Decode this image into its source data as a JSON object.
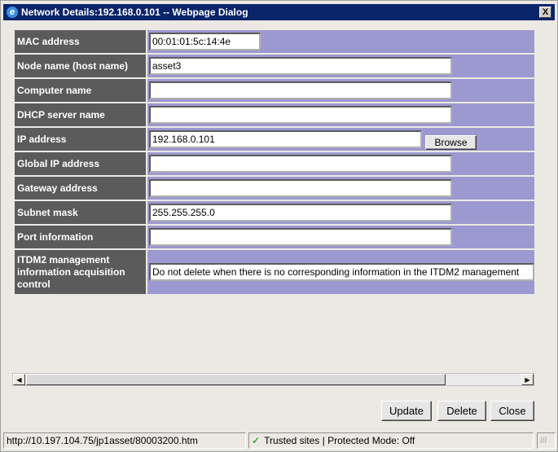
{
  "window": {
    "title": "Network Details:192.168.0.101 -- Webpage Dialog",
    "close_label": "X"
  },
  "fields": [
    {
      "label": "MAC address",
      "value": "00:01:01:5c:14:4e"
    },
    {
      "label": "Node name (host name)",
      "value": "asset3"
    },
    {
      "label": "Computer name",
      "value": ""
    },
    {
      "label": "DHCP server name",
      "value": ""
    },
    {
      "label": "IP address",
      "value": "192.168.0.101",
      "button": "Browse"
    },
    {
      "label": "Global IP address",
      "value": ""
    },
    {
      "label": "Gateway address",
      "value": ""
    },
    {
      "label": "Subnet mask",
      "value": "255.255.255.0"
    },
    {
      "label": "Port information",
      "value": ""
    },
    {
      "label": "ITDM2 management information acquisition control",
      "value": "Do not delete when there is no corresponding information in the ITDM2 management"
    }
  ],
  "buttons": {
    "update": "Update",
    "delete": "Delete",
    "close": "Close"
  },
  "status": {
    "url": "http://10.197.104.75/jp1asset/80003200.htm",
    "zone": "Trusted sites | Protected Mode: Off"
  }
}
